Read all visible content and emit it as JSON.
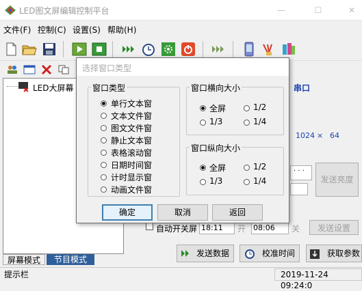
{
  "window": {
    "title": "LED图文屏编辑控制平台",
    "minimize": "—",
    "maximize": "☐",
    "close": "✕"
  },
  "menu": [
    {
      "label": "文件(F)"
    },
    {
      "label": "控制(C)"
    },
    {
      "label": "设置(S)"
    },
    {
      "label": "帮助(H)"
    }
  ],
  "toolbar_icons": [
    "new-file-icon",
    "open-folder-icon",
    "save-icon",
    "play-icon",
    "stop-icon",
    "fast-forward-icon",
    "timer-icon",
    "settings-gear-icon",
    "power-icon",
    "more-arrows-icon",
    "phone-icon",
    "brush-icon",
    "books-icon"
  ],
  "toolbar2_icons": [
    "users-icon",
    "window-icon",
    "delete-icon",
    "copy-icon"
  ],
  "tree": {
    "root_label": "LED大屏幕"
  },
  "right": {
    "port_label": "串口",
    "resolution_w": "1024",
    "resolution_x": "×",
    "resolution_h": "64",
    "send_brightness": "发送亮度",
    "auto_power": "自动开关屏",
    "on_time": "18:11",
    "on_label": "开",
    "off_time": "08:06",
    "off_label": "关",
    "send_settings": "发送设置",
    "send_data": "发送数据",
    "calibrate_time": "校准时间",
    "get_params": "获取参数",
    "dots": "· · ·"
  },
  "dialog": {
    "title": "选择窗口类型",
    "type_group": "窗口类型",
    "types": [
      "单行文本窗",
      "文本文件窗",
      "图文文件窗",
      "静止文本窗",
      "表格滚动窗",
      "日期时间窗",
      "计时显示窗",
      "动画文件窗"
    ],
    "selected_type": 0,
    "h_group": "窗口横向大小",
    "v_group": "窗口纵向大小",
    "size_options": [
      "全屏",
      "1/2",
      "1/3",
      "1/4"
    ],
    "h_selected": 0,
    "v_selected": 0,
    "ok": "确定",
    "cancel": "取消",
    "back": "返回"
  },
  "tabs": {
    "screen_mode": "屏幕模式",
    "program_mode": "节目模式"
  },
  "status": {
    "hint": "提示栏",
    "datetime": "2019-11-24 09:24:0"
  },
  "colors": {
    "accent": "#2f5f9a",
    "tab_active": "#2f5f9a",
    "port_text": "#1a3fb0"
  }
}
